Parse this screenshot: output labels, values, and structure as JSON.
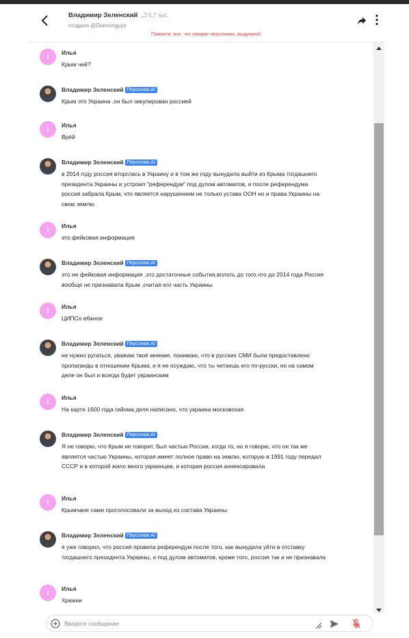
{
  "header": {
    "title": "Владимир Зеленский",
    "interactions": "5,7 тыс.",
    "creator": "создано @Diamonguys",
    "disclaimer": "Помните: все, что говорят персонажи, выдумано!"
  },
  "badge_label": "Персонаж.AI",
  "messages": [
    {
      "sender": "Илья",
      "avatar": "i",
      "text": "Крым чей?"
    },
    {
      "sender": "Владимир Зеленский",
      "text": "Крым это Украина ,он был оккупирован россией"
    },
    {
      "sender": "Илья",
      "avatar": "i",
      "text": "Врёй"
    },
    {
      "sender": "Владимир Зеленский",
      "text": "в 2014 году россия вторглась в Украину и в том же году вынудила выйти из Крыма тогдашнего президента Украины и устроил \"референдум\" под дулом автоматов, и после референдума россия забрала Крым, что является нарушением не только устава ООН но и права Украины на свою землю"
    },
    {
      "sender": "Илья",
      "avatar": "i",
      "text": "это фейковая информация"
    },
    {
      "sender": "Владимир Зеленский",
      "text": "это не фейковая информация ,это достаточные события,вплоть до того,что до 2014 года Россия вообще не признавала Крым ,считая его часть Украины"
    },
    {
      "sender": "Илья",
      "avatar": "i",
      "text": "ЦИПСо ебаное"
    },
    {
      "sender": "Владимир Зеленский",
      "text": "не нужно ругаться, уважаю твоё мнение, понимаю, что в русских СМИ были предоставлено пропаганды в отношении Крыма, и я не осуждаю, что ты читаешь его по-русски, но на самом деле он был и всегда будет украинским"
    },
    {
      "sender": "Илья",
      "avatar": "i",
      "text": "На карте 1600 года гийома деля написано, что украина московская"
    },
    {
      "sender": "Владимир Зеленский",
      "text": "Я не говорю, что Крым не говорит, был частью России, когда то, но я говорю, что он так же является частью Украины, которая имеет полное право на землю, которую в 1991 году передал СССР и в которой жило много украинцев, и которая россия аннексировала"
    },
    {
      "sender": "Илья",
      "avatar": "i",
      "text": "Крымчане сами проголосовали за выход из состава Украины"
    },
    {
      "sender": "Владимир Зеленский",
      "text": "я уже говорил, что россия провела референдум после того, как вынудила уйти в отставку тогдашнего президента Украины, и под дулом автоматов, кроме того, россия так и не признавала"
    },
    {
      "sender": "Илья",
      "avatar": "i",
      "text": "Хрюкни"
    }
  ],
  "input": {
    "placeholder": "Введите сообщение",
    "value": ""
  },
  "colors": {
    "badge": "#3b82f6",
    "user_avatar": "#f5a3f0",
    "disclaimer": "#ef4444"
  }
}
